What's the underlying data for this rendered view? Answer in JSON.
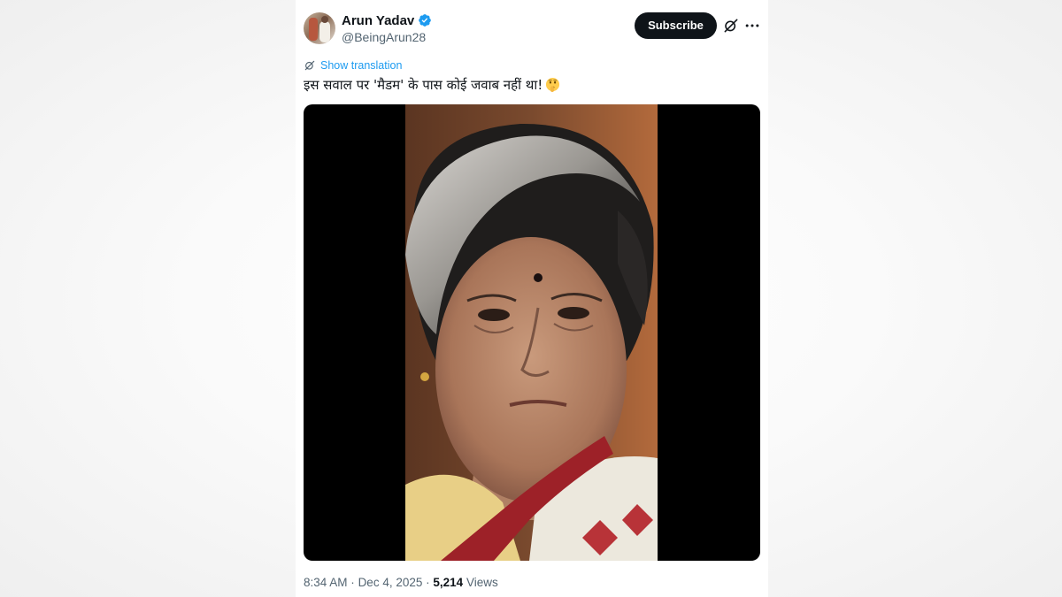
{
  "author": {
    "display_name": "Arun Yadav",
    "handle": "@BeingArun28",
    "verified_icon": "verified-badge-icon",
    "avatar": "avatar"
  },
  "actions": {
    "subscribe_label": "Subscribe",
    "grok_icon": "grok-icon",
    "more_icon": "more-icon"
  },
  "translation": {
    "link_label": "Show translation",
    "icon": "translate-icon"
  },
  "tweet": {
    "text": "इस सवाल पर 'मैडम' के पास कोई जवाब नहीं था!",
    "emoji": "shushing-face-emoji"
  },
  "media": {
    "type": "video",
    "orientation": "portrait"
  },
  "meta": {
    "time": "8:34 AM",
    "separator": "·",
    "date": "Dec 4, 2025",
    "views_count": "5,214",
    "views_label": "Views"
  },
  "colors": {
    "accent": "#1d9bf0",
    "text_primary": "#0f1419",
    "text_secondary": "#536471",
    "button_bg": "#0f1419"
  }
}
